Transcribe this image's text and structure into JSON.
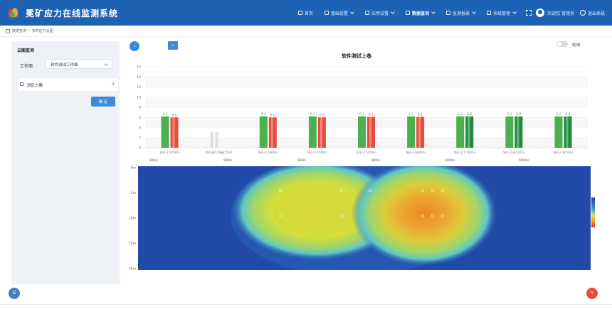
{
  "app": {
    "title": "冕矿应力在线监测系统"
  },
  "nav": {
    "items": [
      {
        "label": "首页",
        "active": false
      },
      {
        "label": "基础设置",
        "active": false
      },
      {
        "label": "应用设置",
        "active": false
      },
      {
        "label": "数据查询",
        "active": true
      },
      {
        "label": "监测报表",
        "active": false
      },
      {
        "label": "系统管理",
        "active": false
      }
    ],
    "user": "欢迎您 管理员",
    "logout": "退出系统"
  },
  "breadcrumb": {
    "items": [
      "数据查询",
      "实时应力云图"
    ]
  },
  "left_panel": {
    "title": "云图查询",
    "workspace_label": "工作面",
    "workspace_value": "软件测试工作面",
    "sensor_group": "测区方案",
    "confirm": "确 定"
  },
  "main": {
    "title": "软件测试上巷",
    "toggle_label": "轮询",
    "back_icon": "arrow-left-icon",
    "next_icon": "arrow-right-icon"
  },
  "colors": {
    "header_bg": "#1e63b3",
    "accent": "#3c8ad8",
    "green": "#4caf50",
    "red": "#e84b3c"
  },
  "chart_data": {
    "type": "bar",
    "ylim": [
      0,
      16
    ],
    "yticks": [
      0,
      2,
      4,
      6,
      8,
      10,
      12,
      14,
      16
    ],
    "categories": [
      "钻孔-2.1(50m)",
      "钻孔测点 残破(75m)",
      "钻孔-2.2(80m)",
      "钻孔-2.4(90m)",
      "钻孔-2.5(70m)",
      "钻孔-2.6(80m)",
      "钻孔-2.7(100m)",
      "钻孔-2.8(110m)",
      "钻孔-2.9(70m)"
    ],
    "series": [
      {
        "values": [
          6.2,
          null,
          6.2,
          6.2,
          6.2,
          6.2,
          6.2,
          6.2,
          6.2
        ],
        "labels": [
          "6.2",
          "",
          "6.2",
          "6.2",
          "6.2",
          "6.2",
          "6.2",
          "6.2",
          "6.2"
        ]
      },
      {
        "values": [
          6.0,
          null,
          6.0,
          6.0,
          6.1,
          6.1,
          6.2,
          6.2,
          6.2
        ],
        "labels": [
          "6.0",
          "",
          "6.0",
          "6.0",
          "6.1",
          "6.1",
          "6.2",
          "6.2",
          "6.2"
        ]
      }
    ],
    "distance_labels": [
      "800m",
      "900m",
      "950m",
      "980m",
      "1000m",
      "1050m"
    ],
    "heatmap": {
      "type": "heatmap",
      "y_labels": [
        "0m",
        "5m",
        "10m",
        "15m",
        "20m"
      ]
    }
  }
}
